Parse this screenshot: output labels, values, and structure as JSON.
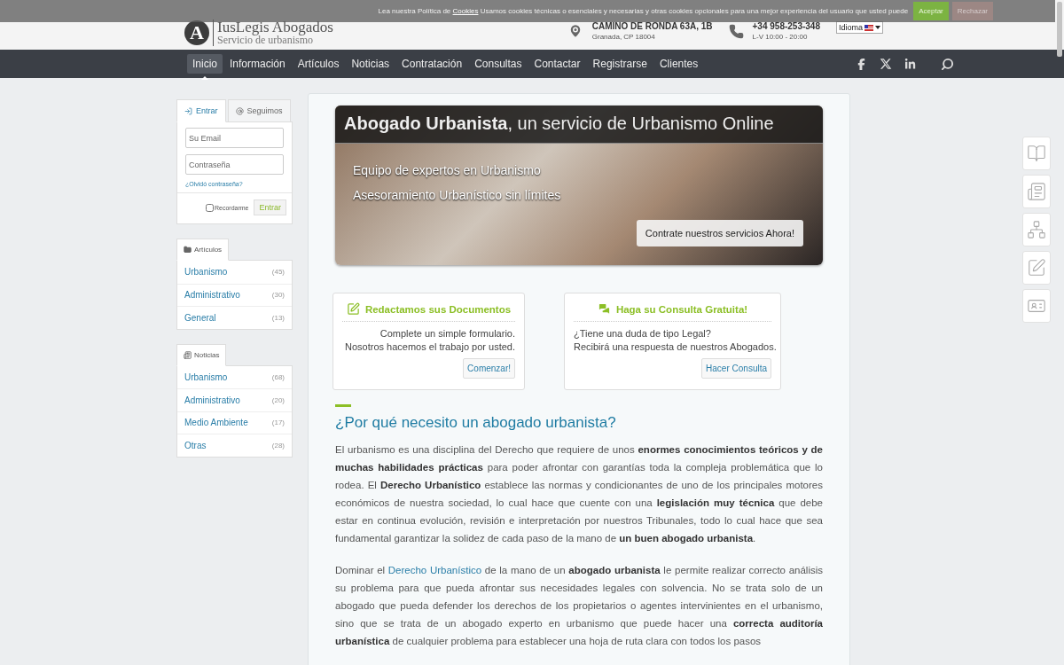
{
  "cookie_banner": {
    "text_before": "Lea nuestra Política de ",
    "link": "Cookies",
    "text_after": " Usamos cookies técnicas o esenciales y necesarias y otras cookies opcionales para una mejor experiencia del usuario que usted puede",
    "buttons": [
      {
        "label": "Aceptar",
        "kind": "accept"
      },
      {
        "label": "Rechazar",
        "kind": "reject"
      }
    ]
  },
  "header": {
    "logo": {
      "mark": "A",
      "name": "IusLegis Abogados",
      "tagline": "Servicio de urbanismo"
    },
    "address": {
      "line1": "CAMINO DE RONDA 63A, 1B",
      "line2": "Granada, CP 18004"
    },
    "phone": {
      "line1": "+34 958-253-348",
      "line2": "L-V 10:00 - 20:00"
    },
    "language": {
      "label": "Idioma"
    }
  },
  "nav": {
    "items": [
      {
        "label": "Inicio",
        "selected": true
      },
      {
        "label": "Información",
        "selected": false
      },
      {
        "label": "Artículos",
        "selected": false
      },
      {
        "label": "Noticias",
        "selected": false
      },
      {
        "label": "Contratación",
        "selected": false
      },
      {
        "label": "Consultas",
        "selected": false
      },
      {
        "label": "Contactar",
        "selected": false
      },
      {
        "label": "Registrarse",
        "selected": false
      },
      {
        "label": "Clientes",
        "selected": false
      }
    ]
  },
  "login": {
    "tabs": [
      {
        "label": "Entrar",
        "selected": true,
        "kind": "login"
      },
      {
        "label": "Seguimos",
        "selected": false,
        "kind": "follow"
      }
    ],
    "email": {
      "placeholder": "Su Email"
    },
    "password": {
      "placeholder": "Contraseña"
    },
    "forgot": "¿Olvidó contraseña?",
    "remember": {
      "label": "Recordarme",
      "checked": false
    },
    "submit": "Entrar"
  },
  "sidebar_lists": [
    {
      "title": "Artículos",
      "kind": "folder",
      "items": [
        {
          "label": "Urbanismo",
          "count": "(45)"
        },
        {
          "label": "Administrativo",
          "count": "(30)"
        },
        {
          "label": "General",
          "count": "(13)"
        }
      ]
    },
    {
      "title": "Noticias",
      "kind": "news",
      "items": [
        {
          "label": "Urbanismo",
          "count": "(68)"
        },
        {
          "label": "Administrativo",
          "count": "(20)"
        },
        {
          "label": "Medio Ambiente",
          "count": "(17)"
        },
        {
          "label": "Otras",
          "count": "(28)"
        }
      ]
    }
  ],
  "hero": {
    "title": "**Abogado Urbanista**, un servicio de Urbanismo Online",
    "lines": [
      "Equipo de expertos en Urbanismo",
      "Asesoramiento Urbanístico sin límites"
    ],
    "button": "Contrate nuestros servicios Ahora!"
  },
  "cards": [
    {
      "kind": "document",
      "title": "Redactamos sus Documentos",
      "lines": [
        "Complete un simple formulario.",
        "Nosotros hacemos el trabajo por usted."
      ],
      "button": "Comenzar!"
    },
    {
      "kind": "chat",
      "title": "Haga su Consulta Gratuita!",
      "lines": [
        "¿Tiene una duda de tipo Legal?",
        "Recibirá una respuesta de nuestros Abogados."
      ],
      "button": "Hacer Consulta"
    }
  ],
  "article": {
    "heading": "¿Por qué necesito un abogado urbanista?",
    "paragraphs": [
      [
        {
          "kind": "text",
          "text": "El urbanismo es una disciplina del Derecho que requiere de unos **enormes conocimientos teóricos y de muchas habilidades prácticas** para poder afrontar con garantías toda la compleja problemática que lo rodea. El **Derecho Urbanístico** establece las normas y condicionantes de uno de los principales motores económicos de nuestra sociedad, lo cual hace que cuente con una **legislación muy técnica** que debe estar en continua evolución, revisión e interpretación por nuestros Tribunales, todo lo cual hace que sea fundamental garantizar la solidez de cada paso de la mano de **un buen abogado urbanista**."
        }
      ],
      [
        {
          "kind": "text",
          "text": "Dominar el "
        },
        {
          "kind": "link",
          "text": "Derecho Urbanístico"
        },
        {
          "kind": "text",
          "text": " de la mano de un **abogado urbanista** le permite realizar correcto análisis su problema para que pueda afrontar sus necesidades legales con solvencia. No se trata solo de un abogado que pueda defender los derechos de los propietarios o agentes intervinientes en el urbanismo, sino que se trata de un abogado experto en urbanismo que puede hacer una **correcta auditoría urbanística** de cualquier problema para establecer una hoja de ruta clara con todos los pasos"
        }
      ]
    ]
  },
  "side_tools": [
    {
      "kind": "book"
    },
    {
      "kind": "news"
    },
    {
      "kind": "sitemap"
    },
    {
      "kind": "edit"
    },
    {
      "kind": "card"
    }
  ]
}
